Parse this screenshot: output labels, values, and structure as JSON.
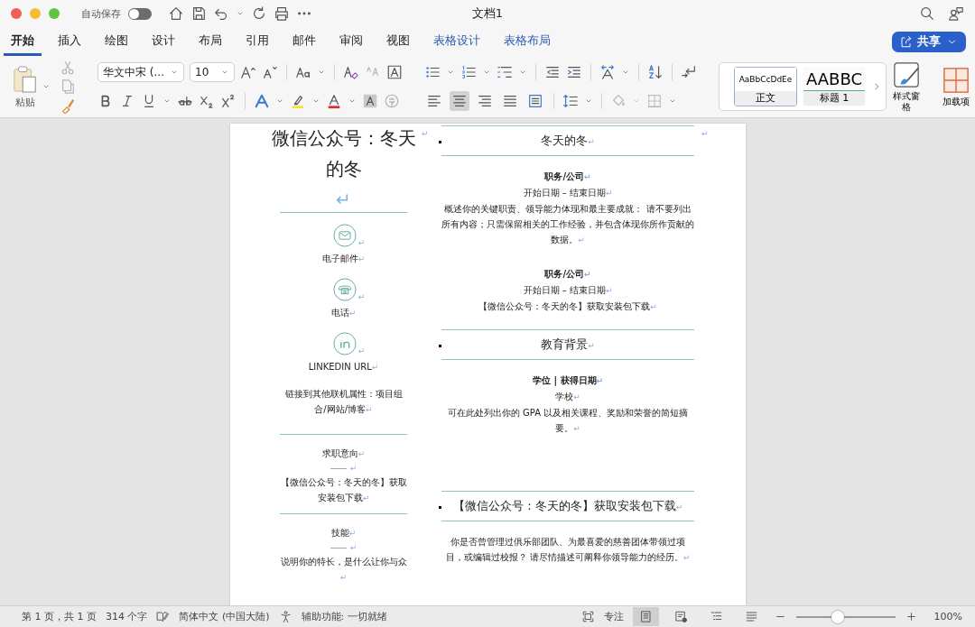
{
  "window": {
    "title": "文档1",
    "autosave_label": "自动保存",
    "autosave_on": false
  },
  "tabs": [
    {
      "label": "开始",
      "selected": true,
      "kind": "main"
    },
    {
      "label": "插入",
      "selected": false,
      "kind": "main"
    },
    {
      "label": "绘图",
      "selected": false,
      "kind": "main"
    },
    {
      "label": "设计",
      "selected": false,
      "kind": "main"
    },
    {
      "label": "布局",
      "selected": false,
      "kind": "main"
    },
    {
      "label": "引用",
      "selected": false,
      "kind": "main"
    },
    {
      "label": "邮件",
      "selected": false,
      "kind": "main"
    },
    {
      "label": "审阅",
      "selected": false,
      "kind": "main"
    },
    {
      "label": "视图",
      "selected": false,
      "kind": "main"
    },
    {
      "label": "表格设计",
      "selected": false,
      "kind": "context"
    },
    {
      "label": "表格布局",
      "selected": false,
      "kind": "context"
    }
  ],
  "share_button": {
    "label": "共享"
  },
  "ribbon": {
    "paste_label": "粘贴",
    "font_name": "华文中宋 (...",
    "font_size": "10",
    "alignments": [
      {
        "kind": "left",
        "selected": false
      },
      {
        "kind": "center",
        "selected": true
      },
      {
        "kind": "right",
        "selected": false
      },
      {
        "kind": "justify",
        "selected": false
      },
      {
        "kind": "distributed",
        "selected": false
      }
    ],
    "styles": [
      {
        "preview": "AaBbCcDdEe",
        "name": "正文",
        "selected": true
      },
      {
        "preview": "AABBC",
        "name": "标题 1",
        "selected": false
      }
    ],
    "styles_pane_label": "样式窗格",
    "addins_label": "加载项"
  },
  "document": {
    "paragraph_mark": "↵",
    "left": {
      "name": "微信公众号：冬天的冬",
      "contacts": [
        {
          "kind": "email",
          "label": "电子邮件"
        },
        {
          "kind": "phone",
          "label": "电话"
        },
        {
          "kind": "linkedin",
          "label": "LINKEDIN URL"
        }
      ],
      "links_text": "链接到其他联机属性：项目组合/网站/博客",
      "sections": [
        {
          "heading": "求职意向",
          "body": "【微信公众号：冬天的冬】获取安装包下载"
        },
        {
          "heading": "技能",
          "body": "说明你的特长，是什么让你与众"
        }
      ]
    },
    "right": {
      "name": "冬天的冬",
      "experience": [
        {
          "title": "职务/公司",
          "dates": "开始日期 – 结束日期",
          "description": "概述你的关键职责、领导能力体现和最主要成就： 请不要列出所有内容；只需保留相关的工作经验，并包含体现你所作贡献的数据。"
        },
        {
          "title": "职务/公司",
          "dates": "开始日期 – 结束日期",
          "description": "【微信公众号：冬天的冬】获取安装包下载"
        }
      ],
      "education_heading": "教育背景",
      "education": [
        {
          "title": "学位 | 获得日期",
          "school": "学校",
          "description": "可在此处列出你的 GPA 以及相关课程、奖励和荣誉的简短摘要。"
        }
      ],
      "extra_heading": "【微信公众号：冬天的冬】获取安装包下载",
      "extra_body": "你是否曾管理过俱乐部团队、为最喜爱的慈善团体带领过项目，或编辑过校报？ 请尽情描述可阐释你领导能力的经历。"
    }
  },
  "status_bar": {
    "page": "第 1 页，共 1 页",
    "words": "314 个字",
    "language": "简体中文 (中国大陆)",
    "accessibility": "辅助功能: 一切就绪",
    "focus": "专注",
    "views": [
      {
        "kind": "print",
        "selected": true
      },
      {
        "kind": "web",
        "selected": false
      },
      {
        "kind": "outline",
        "selected": false
      },
      {
        "kind": "draft",
        "selected": false
      }
    ],
    "zoom": {
      "level": 0.42,
      "reading": "100%"
    }
  }
}
